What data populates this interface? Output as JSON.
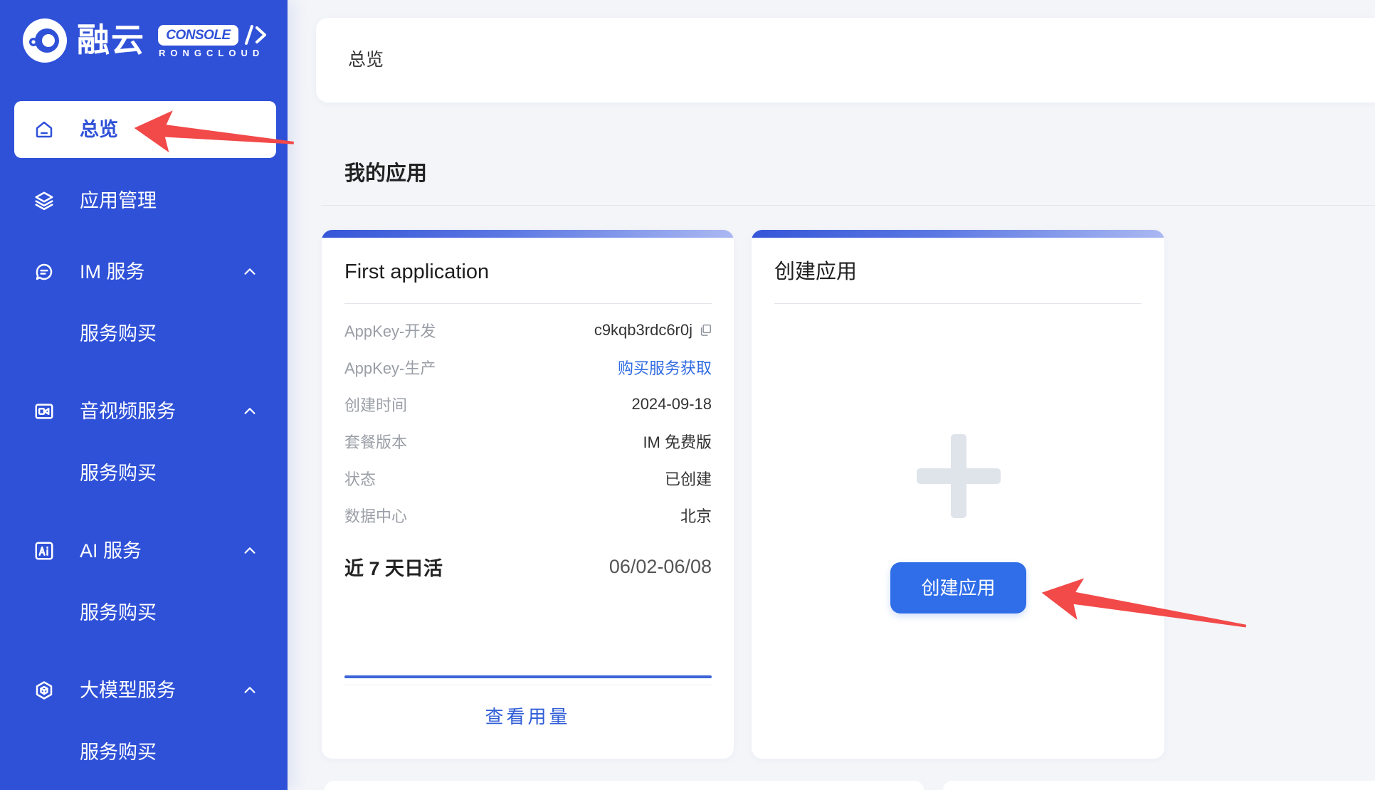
{
  "logo": {
    "name": "融云",
    "badge": "CONSOLE",
    "sub": "RONGCLOUD",
    "icon": "rongcloud-logo-icon"
  },
  "sidebar": {
    "items": [
      {
        "label": "总览",
        "icon": "home-icon",
        "active": true
      },
      {
        "label": "应用管理",
        "icon": "layers-icon"
      },
      {
        "label": "IM 服务",
        "icon": "chat-icon",
        "expanded": true
      },
      {
        "label": "服务购买",
        "sub": true
      },
      {
        "label": "音视频服务",
        "icon": "video-icon",
        "expanded": true
      },
      {
        "label": "服务购买",
        "sub": true
      },
      {
        "label": "AI 服务",
        "icon": "ai-icon",
        "expanded": true
      },
      {
        "label": "服务购买",
        "sub": true
      },
      {
        "label": "大模型服务",
        "icon": "model-icon",
        "expanded": true
      },
      {
        "label": "服务购买",
        "sub": true
      }
    ]
  },
  "header": {
    "title": "总览"
  },
  "section": {
    "title": "我的应用"
  },
  "app_card": {
    "title": "First application",
    "rows": [
      {
        "label": "AppKey-开发",
        "value": "c9kqb3rdc6r0j"
      },
      {
        "label": "AppKey-生产",
        "value": "购买服务获取"
      },
      {
        "label": "创建时间",
        "value": "2024-09-18"
      },
      {
        "label": "套餐版本",
        "value": "IM 免费版"
      },
      {
        "label": "状态",
        "value": "已创建"
      },
      {
        "label": "数据中心",
        "value": "北京"
      }
    ],
    "dau_label": "近 7 天日活",
    "dau_range": "06/02-06/08",
    "usage_button": "查看用量"
  },
  "create_card": {
    "title": "创建应用",
    "button": "创建应用",
    "icon": "plus-icon"
  },
  "colors": {
    "sidebar": "#2f51d8",
    "primary_button": "#2f6ee8",
    "annotation_arrow": "#f24949"
  }
}
